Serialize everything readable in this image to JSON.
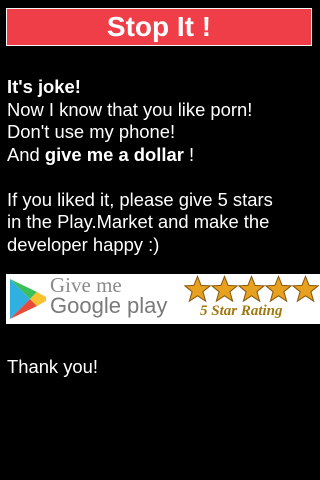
{
  "header": {
    "title": "Stop It !"
  },
  "message": {
    "line1": "It's joke!",
    "line2": "Now I know that you like porn!",
    "line3": "Don't use my phone!",
    "line4_prefix": "And ",
    "line4_bold": "give me a dollar",
    "line4_suffix": " !",
    "para2_line1": "If you liked it, please give 5 stars",
    "para2_line2": "in the Play.Market and make the",
    "para2_line3": "developer happy :)"
  },
  "badge": {
    "line1": "Give me",
    "line2": "Google play",
    "rating_text": "5 Star Rating",
    "star_count": 5,
    "star_icon": "star-icon",
    "logo_icon": "google-play-logo-icon"
  },
  "footer": {
    "thanks": "Thank you!"
  },
  "colors": {
    "background": "#000000",
    "header_bg": "#ef3e47",
    "header_border": "#f4f4f4",
    "text": "#ffffff",
    "star_fill": "#e8a020",
    "rating_text": "#a07810"
  }
}
